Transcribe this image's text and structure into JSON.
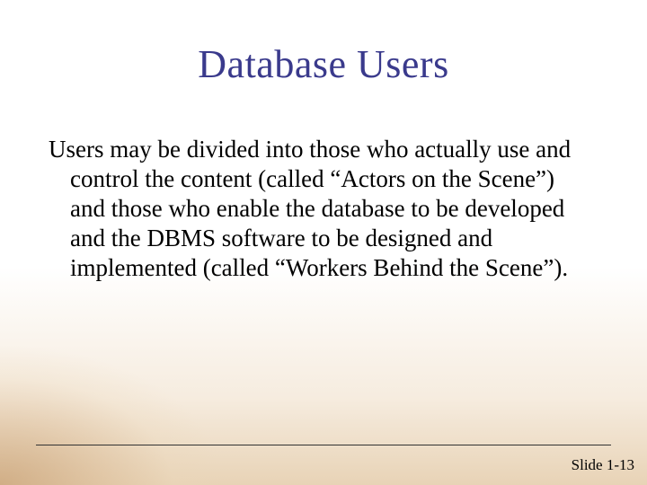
{
  "title": "Database Users",
  "body": "Users may be divided into those who actually use and control the content (called “Actors on the Scene”) and those who enable the database to be developed and the DBMS software to be designed and implemented (called “Workers Behind the Scene”).",
  "footer": {
    "slide_label": "Slide 1-13"
  }
}
